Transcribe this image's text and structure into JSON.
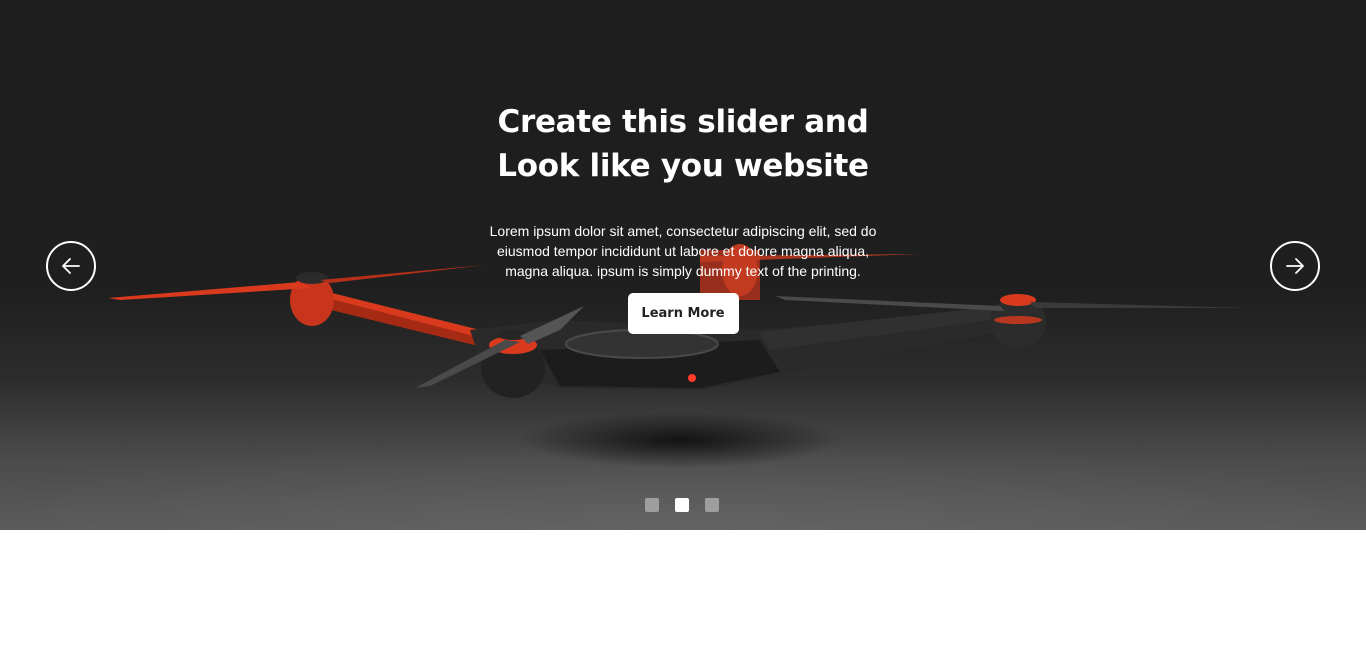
{
  "hero": {
    "headline_line1": "Create this slider and",
    "headline_line2": "Look like you website",
    "body": "Lorem ipsum dolor sit amet, consectetur adipiscing elit, sed do eiusmod tempor incididunt ut labore et dolore magna aliqua, magna aliqua. ipsum is simply dummy text of the printing.",
    "cta_label": "Learn More"
  },
  "slider": {
    "prev_icon": "arrow-left-icon",
    "next_icon": "arrow-right-icon",
    "slide_count": 3,
    "active_slide": 2
  },
  "colors": {
    "background": "#1f1f1f",
    "accent": "#d93a1e",
    "text": "#ffffff",
    "dot_inactive": "#9e9e9e",
    "dot_active": "#ffffff"
  }
}
